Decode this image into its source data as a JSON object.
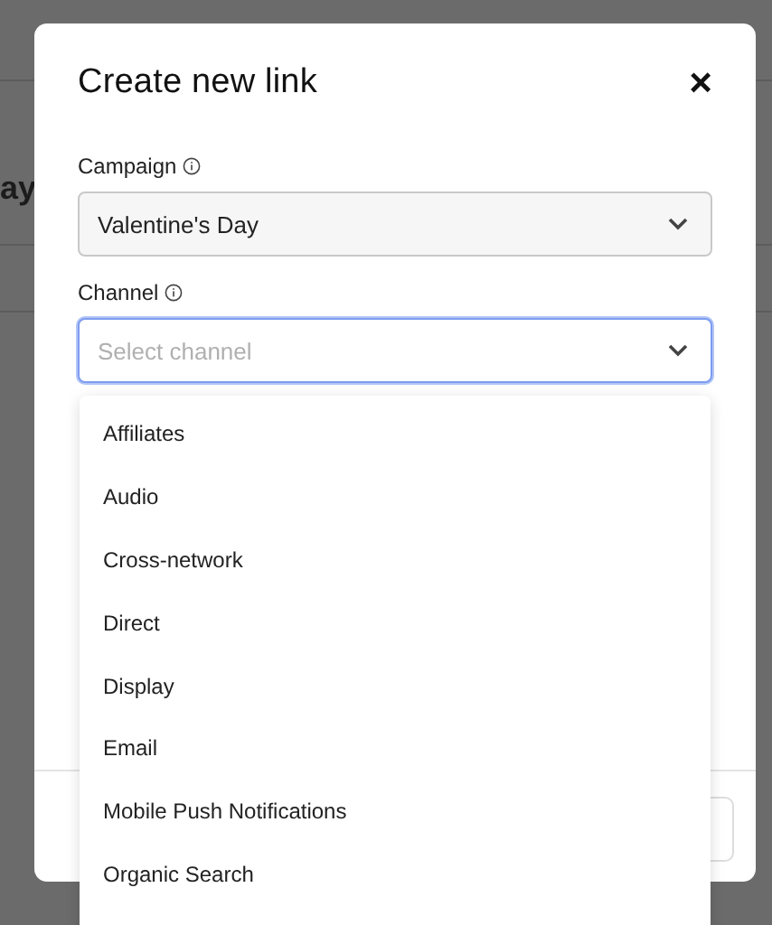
{
  "background": {
    "heading": "ay"
  },
  "dialog": {
    "title": "Create new link",
    "close": "×",
    "fields": [
      {
        "label": "Campaign",
        "value": "Valentine's Day",
        "focused": false
      },
      {
        "label": "Channel",
        "placeholder": "Select channel",
        "focused": true
      }
    ],
    "menu": {
      "items": [
        {
          "label": "Affiliates",
          "selected": false
        },
        {
          "label": "Audio",
          "selected": false
        },
        {
          "label": "Cross-network",
          "selected": false
        },
        {
          "label": "Direct",
          "selected": false
        },
        {
          "label": "Display",
          "selected": false
        },
        {
          "label": "Email",
          "selected": false
        },
        {
          "label": "Mobile Push Notifications",
          "selected": false
        },
        {
          "label": "Organic Search",
          "selected": false
        }
      ]
    }
  }
}
